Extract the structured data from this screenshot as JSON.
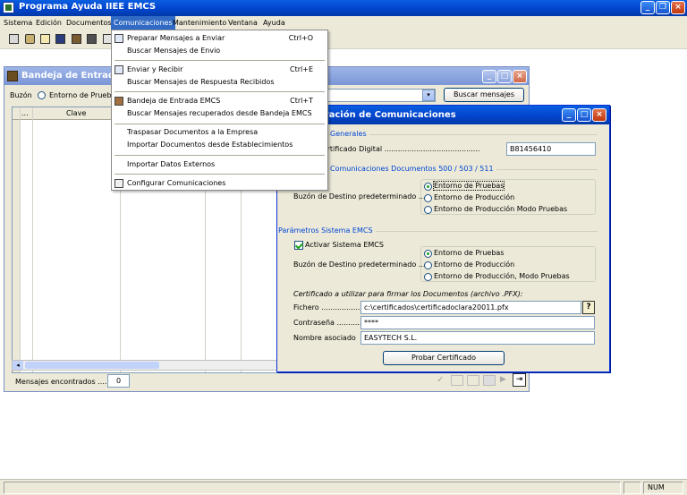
{
  "app": {
    "title": "Programa Ayuda IIEE EMCS"
  },
  "menubar": {
    "items": [
      "Sistema",
      "Edición",
      "Documentos",
      "Comunicaciones",
      "Mantenimiento",
      "Ventana",
      "Ayuda"
    ],
    "active": "Comunicaciones"
  },
  "dropdown": {
    "items": [
      {
        "label": "Preparar Mensajes a Enviar",
        "shortcut": "Ctrl+O"
      },
      {
        "label": "Buscar Mensajes de Envio",
        "shortcut": ""
      },
      {
        "label": "Enviar y Recibir",
        "shortcut": "Ctrl+E"
      },
      {
        "label": "Buscar Mensajes de Respuesta Recibidos",
        "shortcut": ""
      },
      {
        "label": "Bandeja  de Entrada EMCS",
        "shortcut": "Ctrl+T"
      },
      {
        "label": "Buscar Mensajes recuperados desde Bandeja EMCS",
        "shortcut": ""
      },
      {
        "label": "Traspasar Documentos a la Empresa",
        "shortcut": ""
      },
      {
        "label": "Importar Documentos desde Establecimientos",
        "shortcut": ""
      },
      {
        "label": "Importar Datos Externos",
        "shortcut": ""
      },
      {
        "label": "Configurar Comunicaciones",
        "shortcut": ""
      }
    ]
  },
  "bandeja": {
    "title": "Bandeja de Entrada E",
    "buzon_label": "Buzón",
    "buzon_option": "Entorno de Pruebas",
    "search_button": "Buscar mensajes",
    "columns": [
      "...",
      "Clave"
    ],
    "found_label": "Mensajes encontrados ......",
    "found_count": "0"
  },
  "config": {
    "title": "raración de Comunicaciones",
    "general": {
      "title": "Generales",
      "cert_label": "o al Certificado Digital ..........................................",
      "cert_value": "B81456410"
    },
    "docs": {
      "title": "Comunicaciones Documentos 500 / 503 / 511",
      "buzon_label": "Buzón de Destino predeterminado ......",
      "options": [
        "Entorno de Pruebas",
        "Entorno de Producción",
        "Entorno de Producción Modo Pruebas"
      ],
      "selected": 0
    },
    "emcs": {
      "title": "Parámetros Sistema EMCS",
      "activate_label": "Activar Sistema EMCS",
      "activated": true,
      "buzon_label": "Buzón de Destino predeterminado ......",
      "options": [
        "Entorno de Pruebas",
        "Entorno de Producción",
        "Entorno de Producción, Modo Pruebas"
      ],
      "selected": 0
    },
    "cert": {
      "title": "Certificado a utilizar para firmar los Documentos (archivo .PFX):",
      "file_label": "Fichero ...................",
      "file_value": "c:\\certificados\\certificadoclara20011.pfx",
      "password_label": "Contraseña ...........",
      "password_value": "****",
      "name_label": "Nombre asociado",
      "name_value": "EASYTECH S.L."
    },
    "test_button": "Probar Certificado"
  },
  "status": {
    "num": "NUM"
  },
  "colors": {
    "titlebar": "#0346d0",
    "menu_highlight": "#316ac5",
    "group_title": "#0046d5",
    "window_bg": "#ece9d8"
  }
}
